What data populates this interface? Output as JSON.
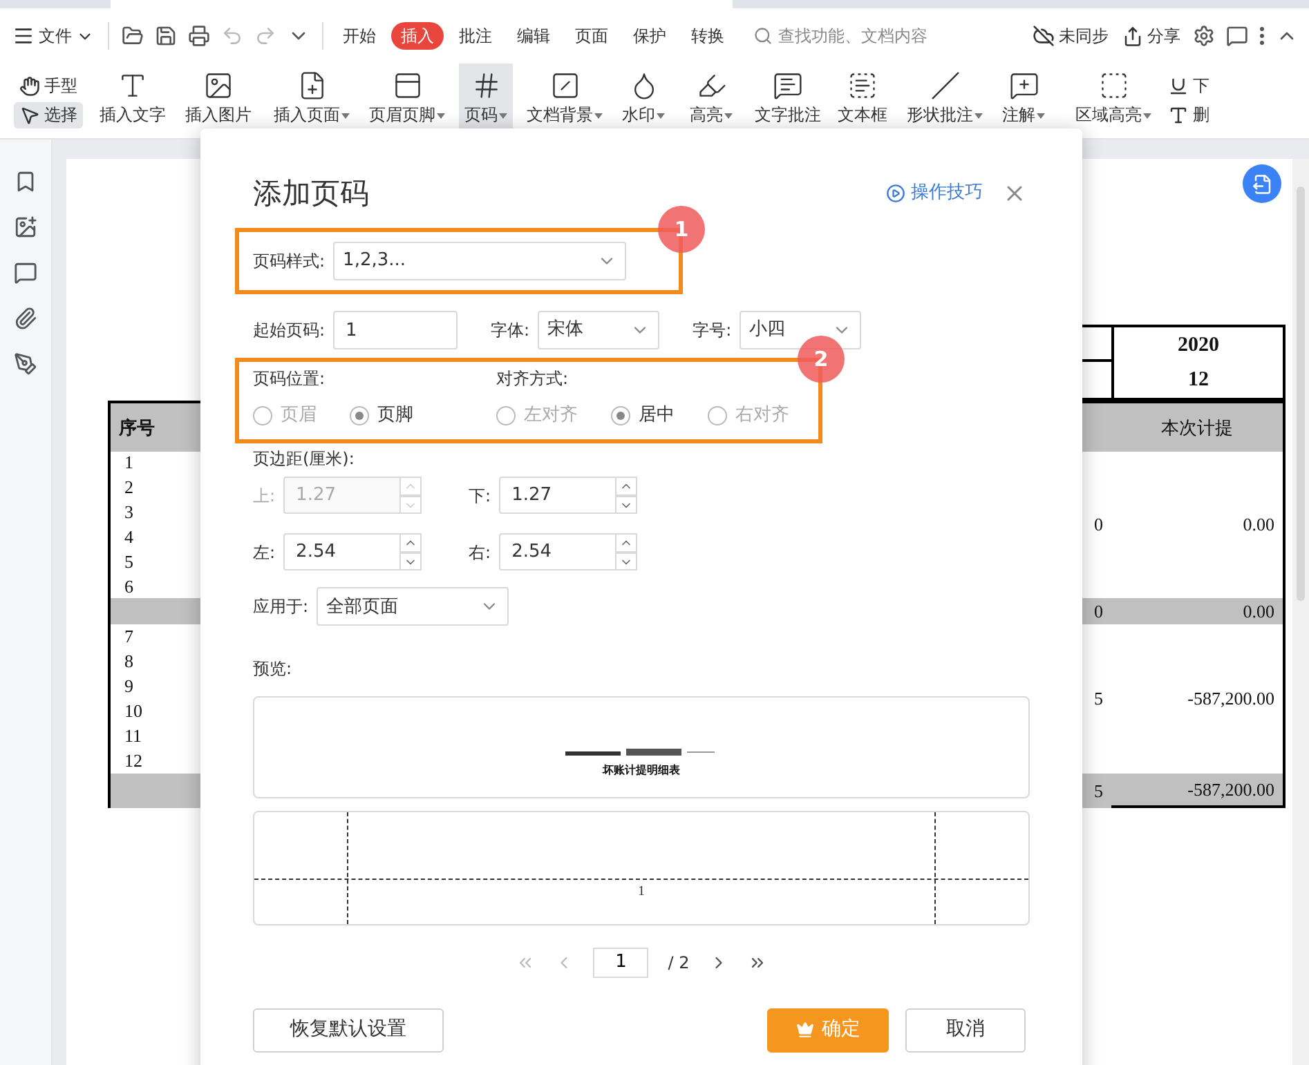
{
  "menu_bar": {
    "file_menu": "文件",
    "tabs": [
      {
        "label": "开始",
        "selected": false
      },
      {
        "label": "插入",
        "selected": true
      },
      {
        "label": "批注",
        "selected": false
      },
      {
        "label": "编辑",
        "selected": false
      },
      {
        "label": "页面",
        "selected": false
      },
      {
        "label": "保护",
        "selected": false
      },
      {
        "label": "转换",
        "selected": false
      }
    ],
    "search": {
      "placeholder": "查找功能、文档内容"
    },
    "sync": "未同步",
    "share": "分享"
  },
  "ribbon": {
    "tools_left": [
      {
        "label": "手型",
        "selected": false
      },
      {
        "label": "选择",
        "selected": true
      }
    ],
    "items": [
      {
        "label": "插入文字",
        "dropdown": false,
        "selected": false
      },
      {
        "label": "插入图片",
        "dropdown": false,
        "selected": false
      },
      {
        "label": "插入页面",
        "dropdown": true,
        "selected": false
      },
      {
        "label": "页眉页脚",
        "dropdown": true,
        "selected": false
      },
      {
        "label": "页码",
        "dropdown": true,
        "selected": true
      },
      {
        "label": "文档背景",
        "dropdown": true,
        "selected": false
      },
      {
        "label": "水印",
        "dropdown": true,
        "selected": false
      },
      {
        "label": "高亮",
        "dropdown": true,
        "selected": false
      },
      {
        "label": "文字批注",
        "dropdown": false,
        "selected": false
      },
      {
        "label": "文本框",
        "dropdown": false,
        "selected": false
      },
      {
        "label": "形状批注",
        "dropdown": true,
        "selected": false
      },
      {
        "label": "注解",
        "dropdown": true,
        "selected": false
      },
      {
        "label": "区域高亮",
        "dropdown": true,
        "selected": false
      }
    ],
    "tools_right": [
      {
        "label": "下"
      },
      {
        "label": "删"
      }
    ]
  },
  "document": {
    "top_rows": [
      "2020",
      "12"
    ],
    "header": {
      "column_1": "序号",
      "last_column": "本次计提"
    },
    "groups": [
      {
        "numbers": [
          "1",
          "2",
          "3",
          "4",
          "5",
          "6"
        ],
        "column_3": "0",
        "last_column": "0.00",
        "subtotal_column_3": "0",
        "subtotal_last_column": "0.00"
      },
      {
        "numbers": [
          "7",
          "8",
          "9",
          "10",
          "11",
          "12"
        ],
        "column_3": "5",
        "last_column": "-587,200.00",
        "subtotal_column_3": "5",
        "subtotal_last_column": "-587,200.00"
      }
    ]
  },
  "dialog": {
    "title": "添加页码",
    "help_link": "操作技巧",
    "page_style": {
      "label": "页码样式:",
      "value": "1,2,3...",
      "annotation": "1"
    },
    "start": {
      "label": "起始页码:",
      "value": "1"
    },
    "font": {
      "label": "字体:",
      "value": "宋体"
    },
    "size": {
      "label": "字号:",
      "value": "小四"
    },
    "placement": {
      "annotation": "2",
      "position": {
        "label": "页码位置:",
        "options": [
          {
            "label": "页眉",
            "selected": false,
            "disabled": true
          },
          {
            "label": "页脚",
            "selected": true,
            "disabled": false
          }
        ]
      },
      "align": {
        "label": "对齐方式:",
        "options": [
          {
            "label": "左对齐",
            "selected": false,
            "disabled": true
          },
          {
            "label": "居中",
            "selected": true,
            "disabled": false
          },
          {
            "label": "右对齐",
            "selected": false,
            "disabled": true
          }
        ]
      }
    },
    "margins": {
      "label": "页边距(厘米):",
      "fields": [
        {
          "label": "上:",
          "value": "1.27",
          "disabled": true
        },
        {
          "label": "下:",
          "value": "1.27",
          "disabled": false
        },
        {
          "label": "左:",
          "value": "2.54",
          "disabled": false
        },
        {
          "label": "右:",
          "value": "2.54",
          "disabled": false
        }
      ]
    },
    "apply": {
      "label": "应用于:",
      "value": "全部页面"
    },
    "preview": {
      "label": "预览:",
      "header_text": "坏账计提明细表",
      "footer_text": "1"
    },
    "pager": {
      "page": "1",
      "total": "/ 2"
    },
    "buttons": {
      "reset": "恢复默认设置",
      "ok": "确定",
      "cancel": "取消"
    }
  }
}
